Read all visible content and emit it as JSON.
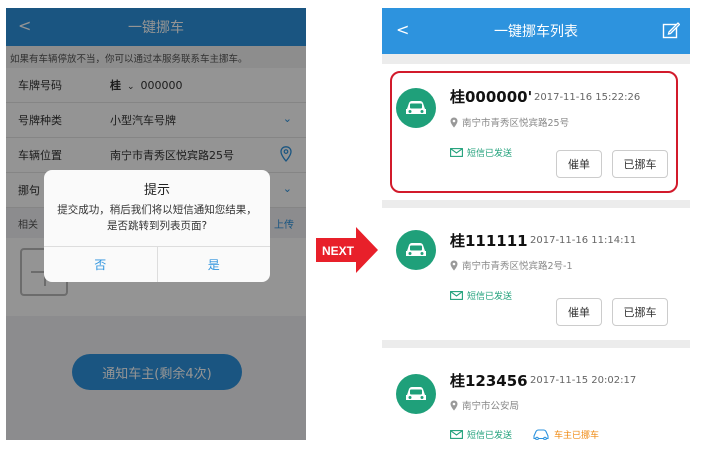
{
  "left_screen": {
    "header_title": "一键挪车",
    "back_glyph": "<",
    "notice": "如果有车辆停放不当，你可以通过本服务联系车主挪车。",
    "fields": {
      "plate_label": "车牌号码",
      "plate_province": "桂",
      "plate_value": "000000",
      "type_label": "号牌种类",
      "type_value": "小型汽车号牌",
      "location_label": "车辆位置",
      "location_value": "南宁市青秀区悦宾路25号",
      "reason_label": "挪句"
    },
    "related_label": "相关",
    "upload_label": "上传",
    "notify_button": "通知车主(剩余4次)",
    "dialog": {
      "title": "提示",
      "message": "提交成功，稍后我们将以短信通知您结果，是否跳转到列表页面?",
      "no_label": "否",
      "yes_label": "是"
    }
  },
  "next_label": "NEXT",
  "right_screen": {
    "header_title": "一键挪车列表",
    "back_glyph": "<",
    "items": [
      {
        "plate": "桂000000'",
        "time": "2017-11-16 15:22:26",
        "address": "南宁市青秀区悦宾路25号",
        "sms_status": "短信已发送",
        "urge_label": "催单",
        "moved_label": "已挪车"
      },
      {
        "plate": "桂111111",
        "time": "2017-11-16 11:14:11",
        "address": "南宁市青秀区悦宾路2号-1",
        "sms_status": "短信已发送",
        "urge_label": "催单",
        "moved_label": "已挪车"
      },
      {
        "plate": "桂123456",
        "time": "2017-11-15 20:02:17",
        "address": "南宁市公安局",
        "sms_status": "短信已发送",
        "owner_moved_status": "车主已挪车"
      }
    ]
  },
  "colors": {
    "primary_blue": "#2d93de",
    "avatar_green": "#1fa07a",
    "highlight_red": "#d21a2b",
    "next_red": "#e8202a",
    "moved_orange": "#ef8a12"
  }
}
